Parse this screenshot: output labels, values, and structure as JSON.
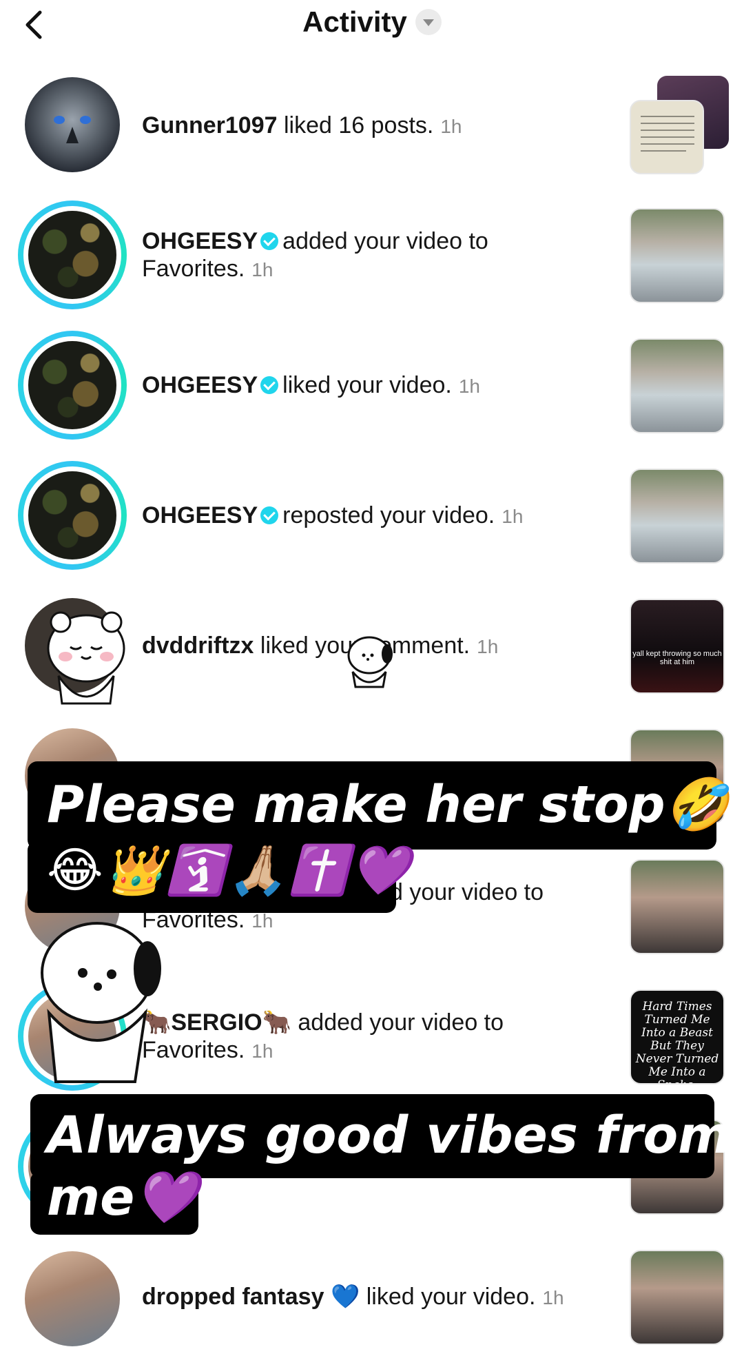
{
  "header": {
    "title": "Activity"
  },
  "rows": [
    {
      "user": "Gunner1097",
      "verified": false,
      "action": "liked 16 posts.",
      "time": "1h"
    },
    {
      "user": "OHGEESY",
      "verified": true,
      "action": "added your video to",
      "action2": "Favorites.",
      "time": "1h"
    },
    {
      "user": "OHGEESY",
      "verified": true,
      "action": "liked your video.",
      "time": "1h"
    },
    {
      "user": "OHGEESY",
      "verified": true,
      "action": "reposted your video.",
      "time": "1h"
    },
    {
      "user": "dvddriftzx",
      "verified": false,
      "action": "liked your comment.",
      "time": "1h"
    },
    {
      "user": "",
      "verified": false,
      "action": "d your video to",
      "action2": "Favorites.",
      "time": "1h"
    },
    {
      "user": "🐂SERGIO🐂",
      "verified": false,
      "action": "added your video to",
      "action2": "Favorites.",
      "time": "1h"
    },
    {
      "user": "dropped fantasy",
      "emoji": "💙",
      "verified": false,
      "action": "liked your video.",
      "time": "1h"
    }
  ],
  "thumb_texts": {
    "night": "yall kept throwing so much shit at him",
    "quote": "Hard Times Turned Me Into a Beast But They Never Turned Me Into a Snake."
  },
  "captions": {
    "first_line": "Please make her stop🤣",
    "first_emojis": "😂👑🛐🙏🏼✝️💜",
    "second_line": "Always good vibes from",
    "second_tail": "me💜"
  },
  "icons": [
    "back-arrow-icon",
    "dropdown-caret-icon",
    "verified-badge-icon"
  ]
}
